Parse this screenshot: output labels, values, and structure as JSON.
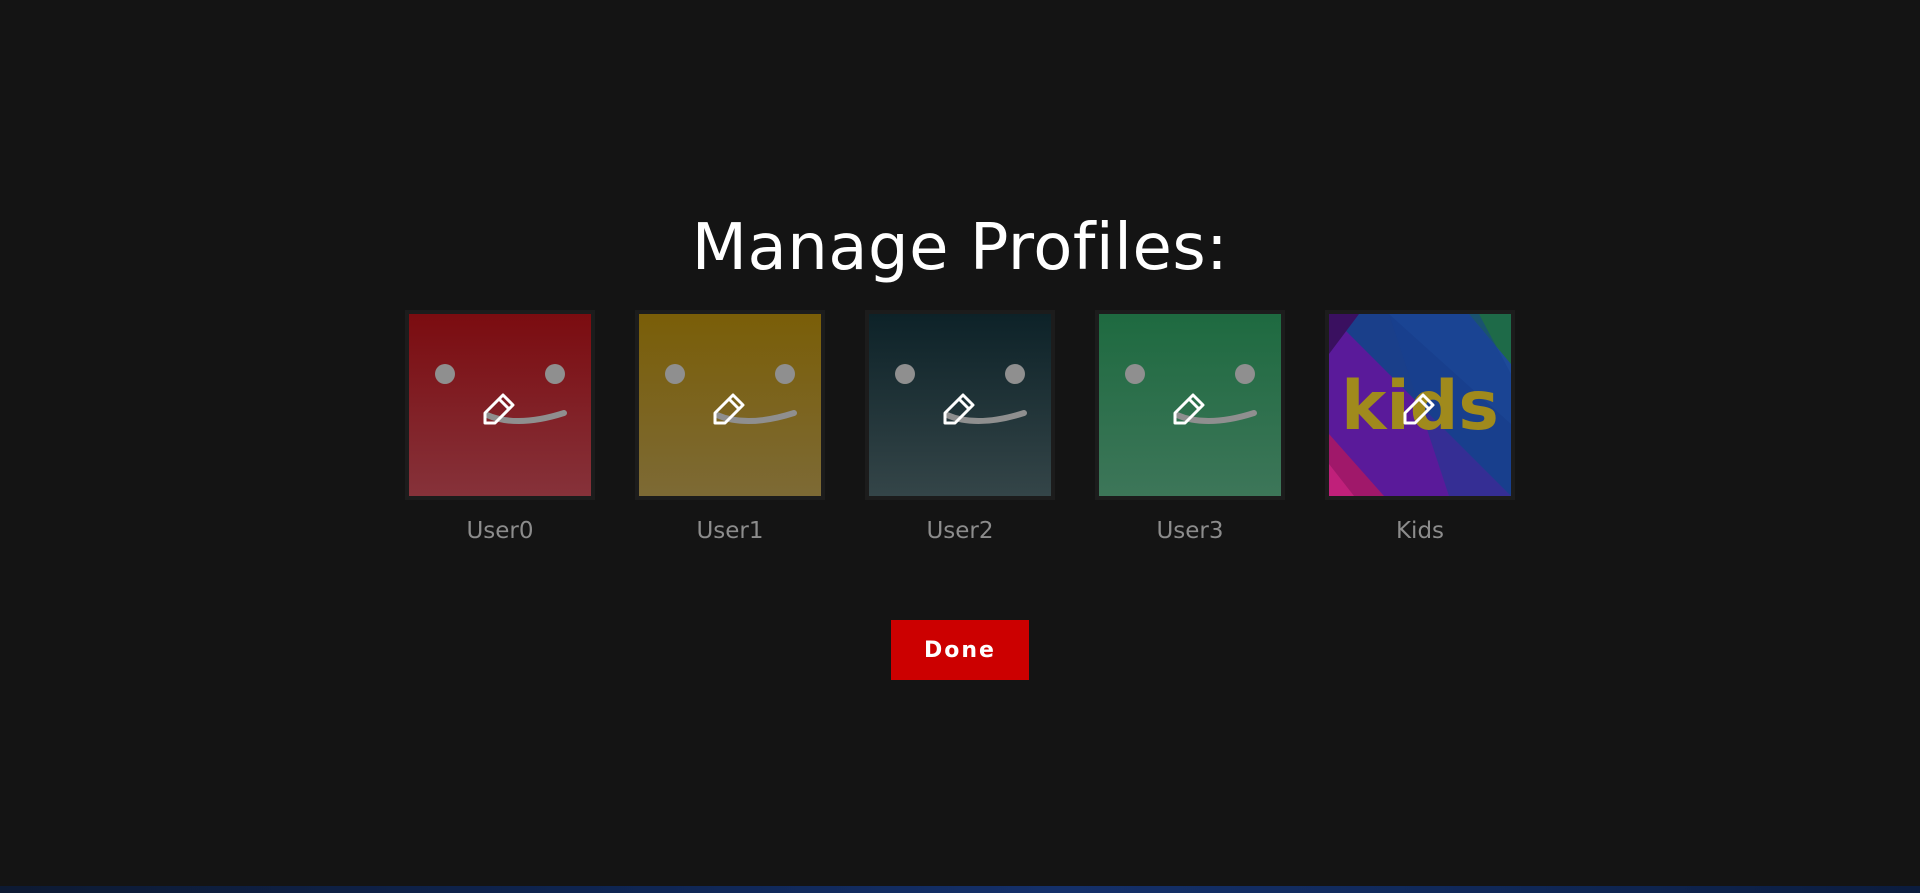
{
  "page": {
    "title": "Manage Profiles:"
  },
  "profiles": [
    {
      "name": "User0",
      "avatar": "smiley",
      "color_top": "#7b0c10",
      "color_bottom": "#86323a",
      "edit_icon": "pencil-icon"
    },
    {
      "name": "User1",
      "avatar": "smiley",
      "color_top": "#7a5e08",
      "color_bottom": "#7d6a35",
      "edit_icon": "pencil-icon"
    },
    {
      "name": "User2",
      "avatar": "smiley",
      "color_top": "#0d2228",
      "color_bottom": "#344548",
      "edit_icon": "pencil-icon"
    },
    {
      "name": "User3",
      "avatar": "smiley",
      "color_top": "#1e6a40",
      "color_bottom": "#3d7659",
      "edit_icon": "pencil-icon"
    },
    {
      "name": "Kids",
      "avatar": "kids-logo",
      "logo_text": "kids",
      "edit_icon": "pencil-icon"
    }
  ],
  "actions": {
    "done_label": "Done"
  },
  "colors": {
    "background": "#141414",
    "title": "#ffffff",
    "profile_name": "#8c8c8c",
    "done_button": "#cc0000",
    "face_features": "#8f8f8f",
    "kids_logo": "#a08a1c"
  }
}
